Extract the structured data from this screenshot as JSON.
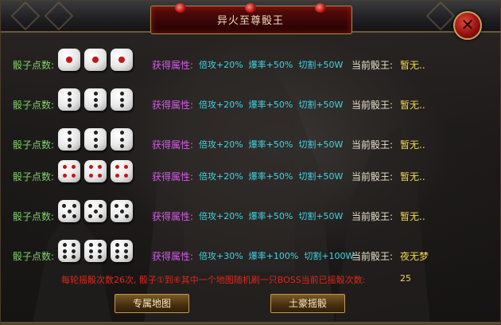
{
  "window": {
    "title": "异火至尊骰王",
    "close_symbol": "✕"
  },
  "rows": [
    {
      "label": "骰子点数:",
      "attr_label": "获得属性:",
      "attr_values": "倍攻+20%  爆率+50%  切割+50W",
      "king_label": "当前骰王:",
      "king_value": "暂无.."
    },
    {
      "label": "骰子点数:",
      "attr_label": "获得属性:",
      "attr_values": "倍攻+20%  爆率+50%  切割+50W",
      "king_label": "当前骰王:",
      "king_value": "暂无.."
    },
    {
      "label": "骰子点数:",
      "attr_label": "获得属性:",
      "attr_values": "倍攻+20%  爆率+50%  切割+50W",
      "king_label": "当前骰王:",
      "king_value": "暂无.."
    },
    {
      "label": "骰子点数:",
      "attr_label": "获得属性:",
      "attr_values": "倍攻+20%  爆率+50%  切割+50W",
      "king_label": "当前骰王:",
      "king_value": "暂无.."
    },
    {
      "label": "骰子点数:",
      "attr_label": "获得属性:",
      "attr_values": "倍攻+20%  爆率+50%  切割+50W",
      "king_label": "当前骰王:",
      "king_value": "暂无.."
    },
    {
      "label": "骰子点数:",
      "attr_label": "获得属性:",
      "attr_values": "倍攻+30%  爆率+100%  切割+100W",
      "king_label": "当前骰王:",
      "king_value": "夜无梦"
    }
  ],
  "dice_faces": [
    1,
    2,
    3,
    4,
    5,
    6
  ],
  "pip_colors": {
    "red": "#c01818",
    "black": "#222222"
  },
  "footer": {
    "info_text": "每轮摇骰次数26次, 骰子①到⑥其中一个地图随机刷一只BOSS当前已摇骰次数:",
    "roll_count": "25"
  },
  "buttons": {
    "map": "专属地图",
    "roll": "土豪摇骰"
  }
}
